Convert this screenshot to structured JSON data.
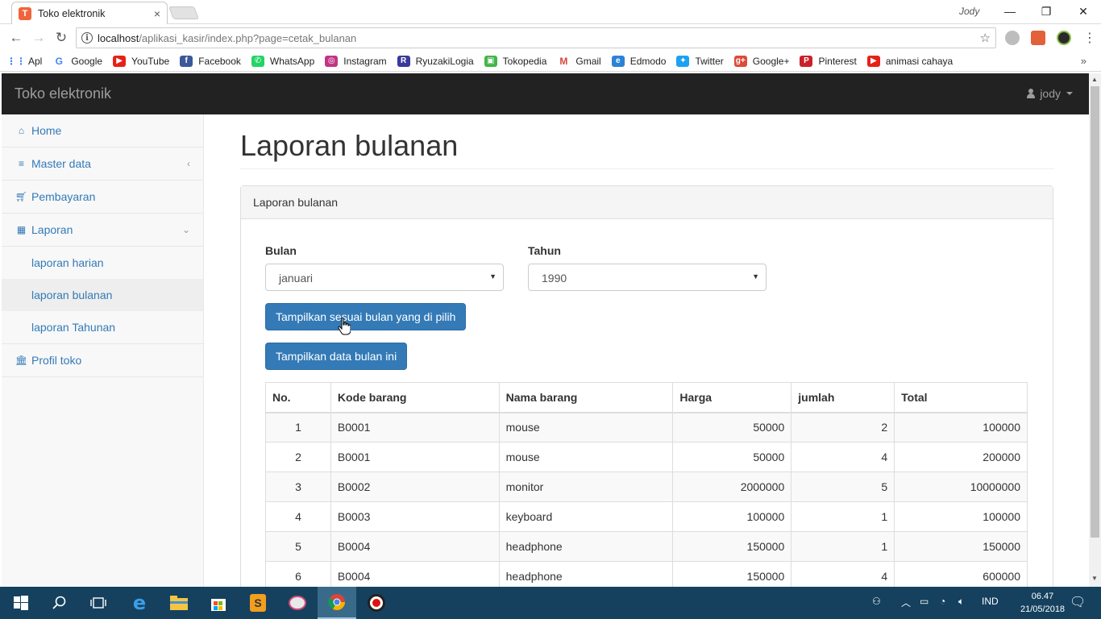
{
  "browser": {
    "tab_title": "Toko elektronik",
    "tab_close": "×",
    "window_user": "Jody",
    "window_controls": {
      "minimize": "—",
      "restore": "❐",
      "close": "✕"
    },
    "url_host": "localhost",
    "url_path": "/aplikasi_kasir/index.php?page=cetak_bulanan",
    "bookmarks": [
      {
        "label": "Apl",
        "icon": "apps-grid-icon",
        "color": "#4285f4"
      },
      {
        "label": "Google",
        "icon": "google-icon",
        "color": "#4285f4"
      },
      {
        "label": "YouTube",
        "icon": "youtube-icon",
        "color": "#e62117"
      },
      {
        "label": "Facebook",
        "icon": "facebook-icon",
        "color": "#3b5998"
      },
      {
        "label": "WhatsApp",
        "icon": "whatsapp-icon",
        "color": "#25d366"
      },
      {
        "label": "Instagram",
        "icon": "instagram-icon",
        "color": "#c13584"
      },
      {
        "label": "RyuzakiLogia",
        "icon": "rl-icon",
        "color": "#3a3a9a"
      },
      {
        "label": "Tokopedia",
        "icon": "tokopedia-icon",
        "color": "#42b549"
      },
      {
        "label": "Gmail",
        "icon": "gmail-icon",
        "color": "#d44638"
      },
      {
        "label": "Edmodo",
        "icon": "edmodo-icon",
        "color": "#2c83d6"
      },
      {
        "label": "Twitter",
        "icon": "twitter-icon",
        "color": "#1da1f2"
      },
      {
        "label": "Google+",
        "icon": "googleplus-icon",
        "color": "#dd4b39"
      },
      {
        "label": "Pinterest",
        "icon": "pinterest-icon",
        "color": "#cb2027"
      },
      {
        "label": "animasi cahaya",
        "icon": "youtube-icon",
        "color": "#e62117"
      }
    ],
    "bookmarks_more": "»"
  },
  "navbar": {
    "brand": "Toko elektronik",
    "user": "jody"
  },
  "sidebar": {
    "items": [
      {
        "label": "Home",
        "icon": "home-icon"
      },
      {
        "label": "Master data",
        "icon": "database-icon",
        "arrow": "‹"
      },
      {
        "label": "Pembayaran",
        "icon": "cart-icon"
      },
      {
        "label": "Laporan",
        "icon": "table-icon",
        "arrow": "⌄"
      },
      {
        "label": "Profil toko",
        "icon": "bank-icon"
      }
    ],
    "laporan_sub": [
      {
        "label": "laporan harian"
      },
      {
        "label": "laporan bulanan",
        "active": true
      },
      {
        "label": "laporan Tahunan"
      }
    ]
  },
  "main": {
    "title": "Laporan bulanan",
    "panel_heading": "Laporan bulanan",
    "bulan_label": "Bulan",
    "bulan_value": "januari",
    "tahun_label": "Tahun",
    "tahun_value": "1990",
    "btn_filter": "Tampilkan sesuai bulan yang di pilih",
    "btn_current": "Tampilkan data bulan ini",
    "table": {
      "headers": [
        "No.",
        "Kode barang",
        "Nama barang",
        "Harga",
        "jumlah",
        "Total"
      ],
      "rows": [
        [
          "1",
          "B0001",
          "mouse",
          "50000",
          "2",
          "100000"
        ],
        [
          "2",
          "B0001",
          "mouse",
          "50000",
          "4",
          "200000"
        ],
        [
          "3",
          "B0002",
          "monitor",
          "2000000",
          "5",
          "10000000"
        ],
        [
          "4",
          "B0003",
          "keyboard",
          "100000",
          "1",
          "100000"
        ],
        [
          "5",
          "B0004",
          "headphone",
          "150000",
          "1",
          "150000"
        ],
        [
          "6",
          "B0004",
          "headphone",
          "150000",
          "4",
          "600000"
        ]
      ]
    }
  },
  "taskbar": {
    "lang": "IND",
    "time": "06.47",
    "date": "21/05/2018"
  },
  "colors": {
    "primary": "#337ab7",
    "navbar": "#222222",
    "taskbar": "#15415f"
  }
}
